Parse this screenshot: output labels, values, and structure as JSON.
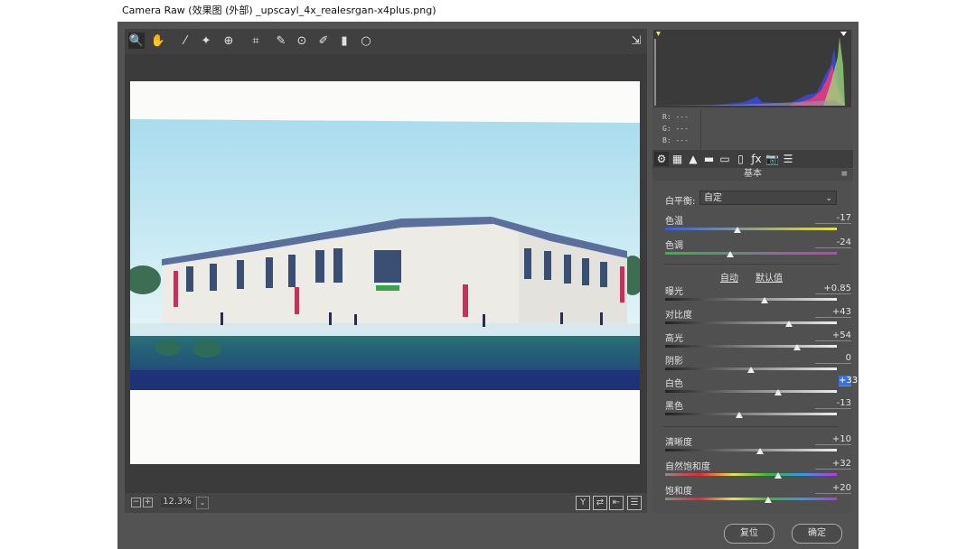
{
  "window": {
    "title": "Camera Raw (效果图 (外部) _upscayl_4x_realesrgan-x4plus.png)"
  },
  "toolbar": {
    "tools": [
      {
        "name": "zoom-tool",
        "glyph": "🔍"
      },
      {
        "name": "hand-tool",
        "glyph": "✋"
      },
      {
        "name": "white-balance-tool",
        "glyph": "⁄"
      },
      {
        "name": "color-sampler-tool",
        "glyph": "✦"
      },
      {
        "name": "targeted-adjustment-tool",
        "glyph": "⊕"
      },
      {
        "name": "crop-tool",
        "glyph": "⌗"
      },
      {
        "name": "spot-removal-tool",
        "glyph": "✎"
      },
      {
        "name": "red-eye-tool",
        "glyph": "⊙"
      },
      {
        "name": "adjustment-brush-tool",
        "glyph": "✐"
      },
      {
        "name": "graduated-filter-tool",
        "glyph": "▮"
      },
      {
        "name": "radial-filter-tool",
        "glyph": "○"
      }
    ],
    "open_preferences_glyph": "⇲"
  },
  "status": {
    "zoom": "12.3%",
    "view_buttons": [
      "Y",
      "⇄",
      "⇤",
      "☰"
    ]
  },
  "rgb_readout": {
    "r": "R: ---",
    "g": "G: ---",
    "b": "B: ---"
  },
  "panel": {
    "title": "基本",
    "tabs": [
      "⚙",
      "▦",
      "▲",
      "▬",
      "▭",
      "▯",
      "ƒx",
      "📷",
      "☰"
    ],
    "white_balance": {
      "label": "白平衡:",
      "value": "自定"
    },
    "auto_label": "自动",
    "default_label": "默认值",
    "sliders": [
      {
        "label": "色温",
        "value": "-17",
        "position": 0.42,
        "gradient": "linear-gradient(to right,#3a5bd8,#e8e24a)"
      },
      {
        "label": "色调",
        "value": "-24",
        "position": 0.38,
        "gradient": "linear-gradient(to right,#2fb84a,#c23fc2)"
      },
      {
        "label": "曝光",
        "value": "+0.85",
        "position": 0.58,
        "gradient": "linear-gradient(to right,#222,#eee)"
      },
      {
        "label": "对比度",
        "value": "+43",
        "position": 0.72,
        "gradient": "linear-gradient(to right,#222,#eee)"
      },
      {
        "label": "高光",
        "value": "+54",
        "position": 0.77,
        "gradient": "linear-gradient(to right,#222,#eee)"
      },
      {
        "label": "阴影",
        "value": "0",
        "position": 0.5,
        "gradient": "linear-gradient(to right,#222,#eee)"
      },
      {
        "label": "白色",
        "value": "+33",
        "position": 0.66,
        "gradient": "linear-gradient(to right,#222,#eee)"
      },
      {
        "label": "黑色",
        "value": "-13",
        "position": 0.43,
        "gradient": "linear-gradient(to right,#222,#eee)"
      },
      {
        "label": "清晰度",
        "value": "+10",
        "position": 0.55,
        "gradient": "linear-gradient(to right,#222,#eee)"
      },
      {
        "label": "自然饱和度",
        "value": "+32",
        "position": 0.66,
        "gradient": "linear-gradient(to right,#8a8a8a,#e23,#e8e24a,#3b3,#39e,#b3e)"
      },
      {
        "label": "饱和度",
        "value": "+20",
        "position": 0.6,
        "gradient": "linear-gradient(to right,#8a8a8a,#e23,#e8e24a,#3b3,#39e,#b3e)"
      }
    ]
  },
  "buttons": {
    "reset": "复位",
    "ok": "确定"
  },
  "colors": {
    "dialog_bg": "#535353",
    "panel_bg": "#505050",
    "accent_selection": "#3d6fd6"
  }
}
